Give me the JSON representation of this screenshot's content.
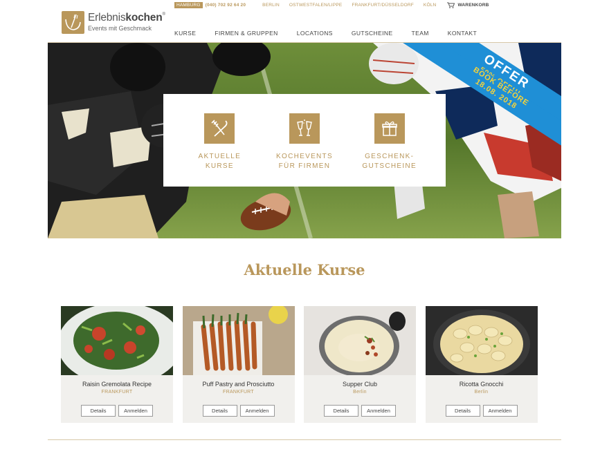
{
  "brand": {
    "name_regular": "Erlebnis",
    "name_bold": "kochen",
    "registered": "®",
    "tagline": "Events mit Geschmack",
    "color": "#b9975b"
  },
  "topbar": {
    "city": "HAMBURG",
    "phone": "(040) 702 92 64 20",
    "links": [
      "BERLIN",
      "OSTWESTFALEN/LIPPE",
      "FRANKFURT/DÜSSELDORF",
      "KÖLN"
    ],
    "cart_label": "WARENKORB",
    "cart_icon": "cart-icon"
  },
  "nav": {
    "items": [
      "KURSE",
      "FIRMEN & GRUPPEN",
      "LOCATIONS",
      "GUTSCHEINE",
      "TEAM",
      "KONTAKT"
    ]
  },
  "hero": {
    "items": [
      {
        "label_line1": "AKTUELLE",
        "label_line2": "KURSE",
        "icon": "utensils-icon"
      },
      {
        "label_line1": "KOCHEVENTS",
        "label_line2": "FÜR FIRMEN",
        "icon": "champagne-glasses-icon"
      },
      {
        "label_line1": "GESCHENK-",
        "label_line2": "GUTSCHEINE",
        "icon": "gift-icon"
      }
    ],
    "offer": {
      "title": "OFFER",
      "line1": "50% OFF!!!",
      "line2": "BOOK BEFORE",
      "line3": "18.08. 2018",
      "color": "#1f8fd6"
    }
  },
  "section": {
    "title": "Aktuelle Kurse"
  },
  "courses": [
    {
      "title": "Raisin Gremolata Recipe",
      "location": "FRANKFURT",
      "details_label": "Details",
      "register_label": "Anmelden"
    },
    {
      "title": "Puff Pastry and Prosciutto",
      "location": "FRANKFURT",
      "details_label": "Details",
      "register_label": "Anmelden"
    },
    {
      "title": "Supper Club",
      "location": "Berlin",
      "details_label": "Details",
      "register_label": "Anmelden"
    },
    {
      "title": "Ricotta Gnocchi",
      "location": "Berlin",
      "details_label": "Details",
      "register_label": "Anmelden"
    }
  ]
}
